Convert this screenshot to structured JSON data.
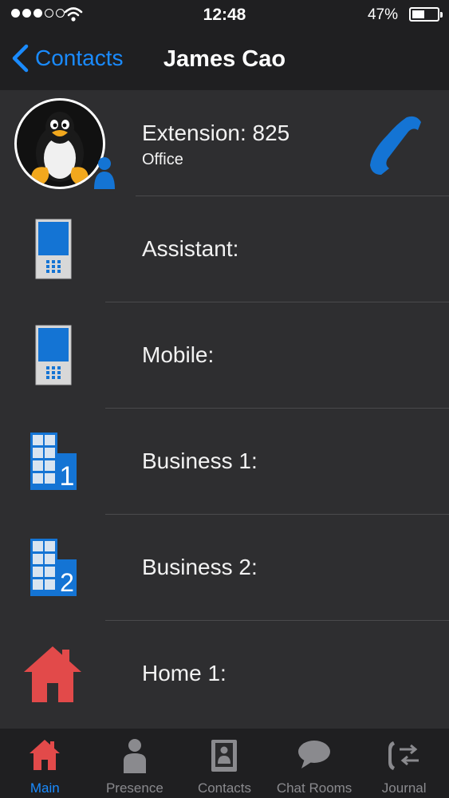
{
  "status_bar": {
    "time": "12:48",
    "battery": "47%"
  },
  "nav": {
    "back_label": "Contacts",
    "title": "James Cao"
  },
  "rows": [
    {
      "label": "Extension: 825",
      "sublabel": "Office"
    },
    {
      "label": "Assistant:"
    },
    {
      "label": "Mobile:"
    },
    {
      "label": "Business 1:"
    },
    {
      "label": "Business 2:"
    },
    {
      "label": "Home 1:"
    }
  ],
  "tabs": [
    {
      "label": "Main",
      "active": true
    },
    {
      "label": "Presence"
    },
    {
      "label": "Contacts"
    },
    {
      "label": "Chat Rooms"
    },
    {
      "label": "Journal"
    }
  ],
  "colors": {
    "accent": "#1a8bff",
    "icon_blue": "#1474d4",
    "home_red": "#e24a4a",
    "background": "#2e2e30",
    "bar": "#1f1f21"
  },
  "icons": [
    "back-chevron-icon",
    "phone-handset-icon",
    "mobile-phone-icon",
    "building-icon",
    "house-icon",
    "person-icon",
    "address-book-icon",
    "chat-bubble-icon",
    "journal-phone-icon"
  ]
}
